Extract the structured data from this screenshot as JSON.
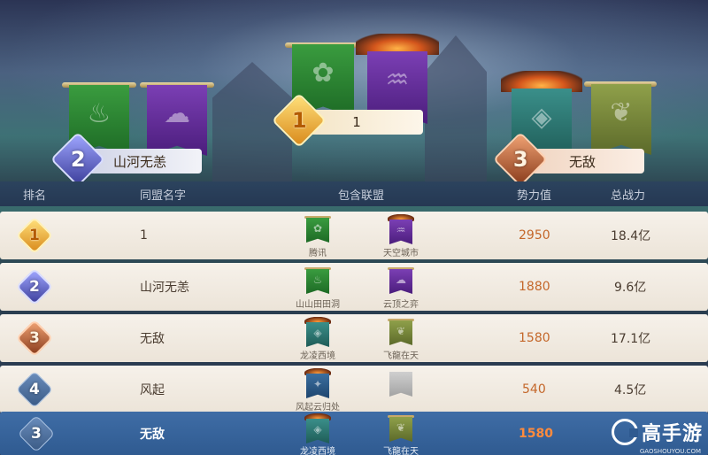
{
  "podium": {
    "first": {
      "rank": "1",
      "name": "1"
    },
    "second": {
      "rank": "2",
      "name": "山河无恙"
    },
    "third": {
      "rank": "3",
      "name": "无敌"
    }
  },
  "table": {
    "headers": {
      "rank": "排名",
      "alliance_name": "同盟名字",
      "members": "包含联盟",
      "power": "势力值",
      "combat": "总战力"
    },
    "rows": [
      {
        "rank": "1",
        "name": "1",
        "member_a": "腾讯",
        "member_b": "天空城市",
        "power": "2950",
        "combat": "18.4亿"
      },
      {
        "rank": "2",
        "name": "山河无恙",
        "member_a": "山山田田洞",
        "member_b": "云顶之弈",
        "power": "1880",
        "combat": "9.6亿"
      },
      {
        "rank": "3",
        "name": "无敌",
        "member_a": "龙凌西境",
        "member_b": "飞龍在天",
        "power": "1580",
        "combat": "17.1亿"
      },
      {
        "rank": "4",
        "name": "风起",
        "member_a": "风起云归处",
        "member_b": "",
        "power": "540",
        "combat": "4.5亿"
      }
    ],
    "current": {
      "rank": "3",
      "name": "无敌",
      "member_a": "龙凌西境",
      "member_b": "飞龍在天",
      "power": "1580"
    }
  },
  "watermark": {
    "brand": "高手游",
    "url": "GAOSHOUYOU.COM"
  },
  "colors": {
    "power_text": "#c4672a",
    "highlight_row": "#2f5a90",
    "row_bg": "#f6f1ea"
  },
  "icons": [
    "gold-rank-medal",
    "silver-rank-medal",
    "bronze-rank-medal",
    "blue-rank-badge",
    "alliance-banner",
    "crown-ornament"
  ]
}
